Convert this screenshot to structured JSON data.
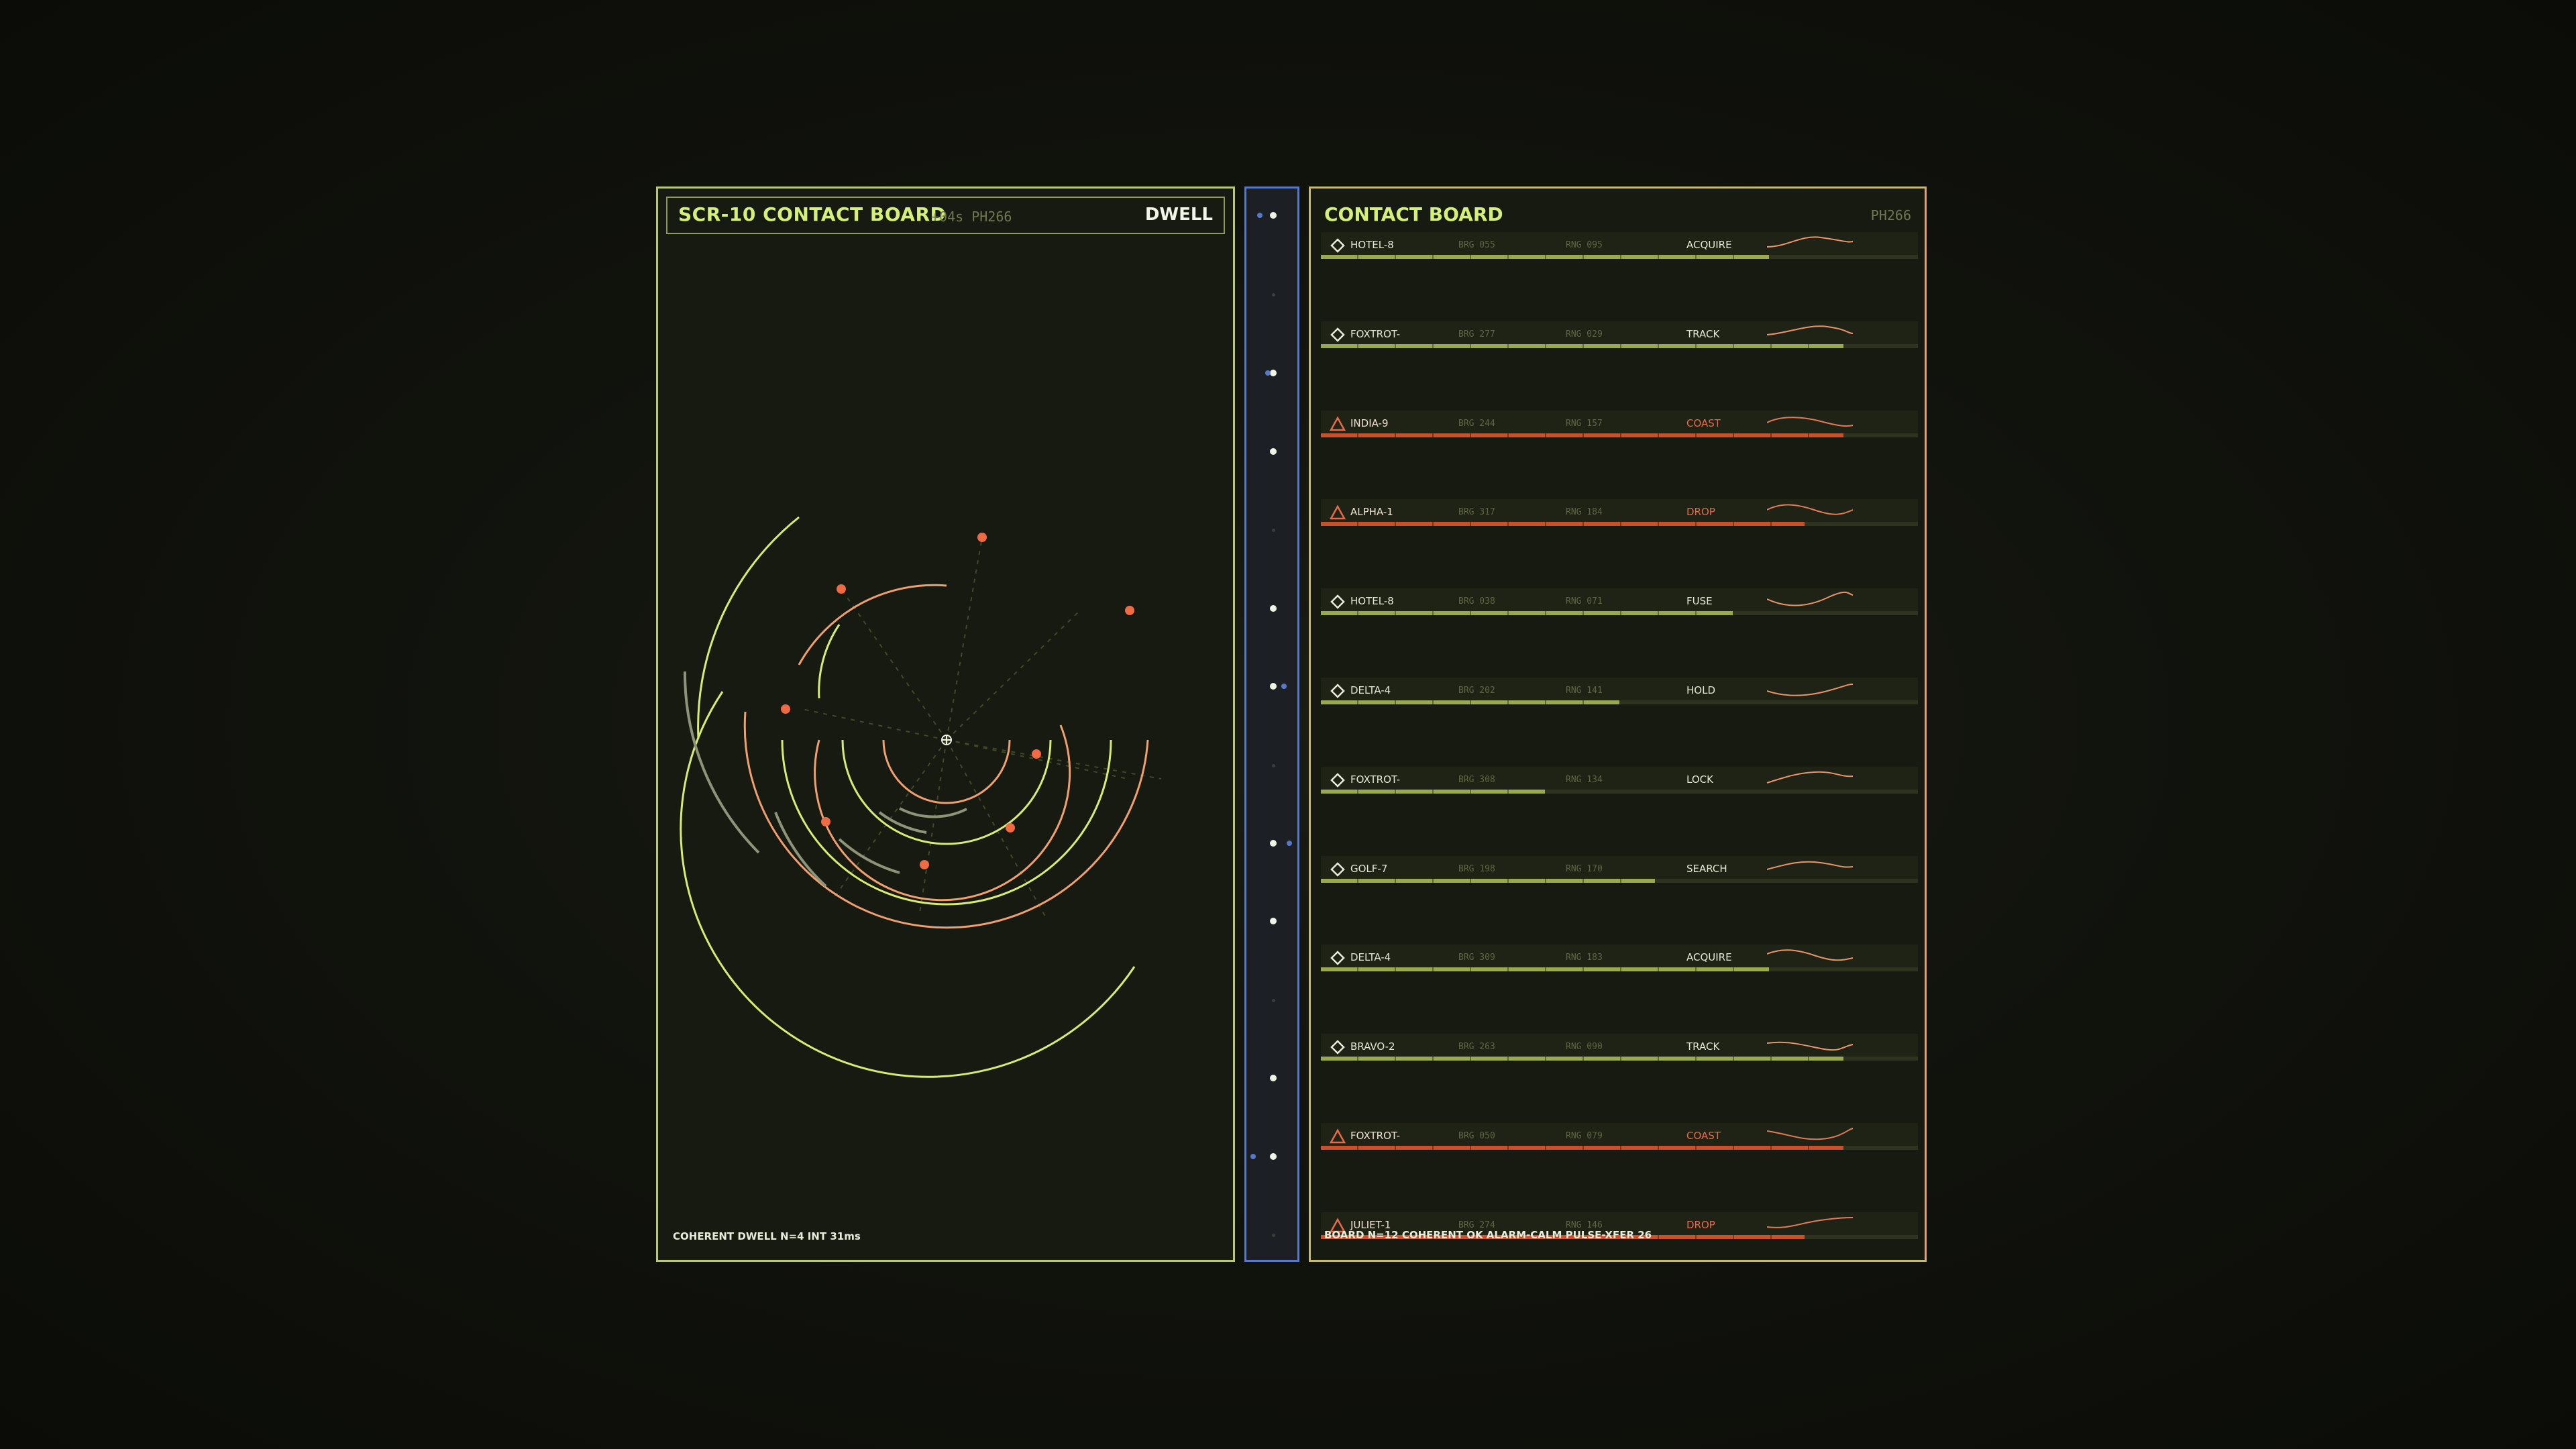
{
  "scope": {
    "title": "SCR-10  CONTACT BOARD",
    "meta": "+04s  PH266",
    "mode": "DWELL",
    "footer": "COHERENT DWELL  N=4  INT 31ms"
  },
  "board": {
    "title": "CONTACT BOARD",
    "phase": "PH266",
    "footer": "BOARD N=12  COHERENT OK  ALARM-CALM  PULSE-XFER 26"
  },
  "colors": {
    "accent": "#d4ef7a",
    "normal_bar": "#9aa84e",
    "alert_bar": "#c8502c",
    "contact_dot": "#f06a44",
    "ring_yellow": "#d8ec74",
    "ring_orange": "#f0a070",
    "rail_border": "#5878c8"
  },
  "contacts": [
    {
      "name": "HOTEL-8",
      "brg": "BRG 055",
      "rng": "RNG 095",
      "state": "ACQUIRE",
      "alert": false,
      "fill": 0.75
    },
    {
      "name": "FOXTROT-",
      "brg": "BRG 277",
      "rng": "RNG 029",
      "state": "TRACK",
      "alert": false,
      "fill": 0.875
    },
    {
      "name": "INDIA-9",
      "brg": "BRG 244",
      "rng": "RNG 157",
      "state": "COAST",
      "alert": true,
      "fill": 0.875
    },
    {
      "name": "ALPHA-1",
      "brg": "BRG 317",
      "rng": "RNG 184",
      "state": "DROP",
      "alert": true,
      "fill": 0.81
    },
    {
      "name": "HOTEL-8",
      "brg": "BRG 038",
      "rng": "RNG 071",
      "state": "FUSE",
      "alert": false,
      "fill": 0.69
    },
    {
      "name": "DELTA-4",
      "brg": "BRG 202",
      "rng": "RNG 141",
      "state": "HOLD",
      "alert": false,
      "fill": 0.5
    },
    {
      "name": "FOXTROT-",
      "brg": "BRG 308",
      "rng": "RNG 134",
      "state": "LOCK",
      "alert": false,
      "fill": 0.375
    },
    {
      "name": "GOLF-7",
      "brg": "BRG 198",
      "rng": "RNG 170",
      "state": "SEARCH",
      "alert": false,
      "fill": 0.56
    },
    {
      "name": "DELTA-4",
      "brg": "BRG 309",
      "rng": "RNG 183",
      "state": "ACQUIRE",
      "alert": false,
      "fill": 0.75
    },
    {
      "name": "BRAVO-2",
      "brg": "BRG 263",
      "rng": "RNG 090",
      "state": "TRACK",
      "alert": false,
      "fill": 0.875
    },
    {
      "name": "FOXTROT-",
      "brg": "BRG 050",
      "rng": "RNG 079",
      "state": "COAST",
      "alert": true,
      "fill": 0.875
    },
    {
      "name": "JULIET-1",
      "brg": "BRG 274",
      "rng": "RNG 146",
      "state": "DROP",
      "alert": true,
      "fill": 0.81
    }
  ],
  "icons": {
    "normal": "diamond-icon",
    "alert": "warning-triangle-icon"
  }
}
